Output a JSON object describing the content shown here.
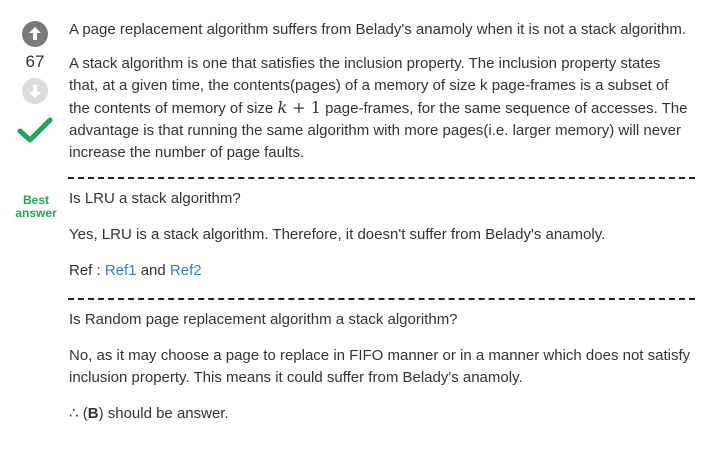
{
  "votes": {
    "count": "67",
    "upvote_icon": "arrow-up-circle-icon",
    "downvote_icon": "arrow-down-circle-icon",
    "accepted_icon": "checkmark-icon",
    "accepted_color": "#1ea756",
    "best_answer_line1": "Best",
    "best_answer_line2": "answer"
  },
  "answer": {
    "p1": "A page replacement algorithm suffers from Belady's anamoly when it is not a stack algorithm.",
    "p2_part1": "A stack algorithm is one that satisfies the inclusion property. The inclusion property states that, at a given time, the contents(pages) of a memory of size k page-frames is a subset of the contents of memory of size ",
    "p2_math_k": "k",
    "p2_math_plus": " + 1",
    "p2_part2": " page-frames, for the same sequence of accesses. The advantage is that running the same algorithm with more pages(i.e. larger memory) will never increase the number of page faults.",
    "q1": "Is LRU a stack algorithm?",
    "a1": "Yes, LRU is a stack algorithm. Therefore, it doesn't suffer from Belady's anamoly.",
    "ref_label": "Ref : ",
    "ref1": "Ref1",
    "ref_and": " and ",
    "ref2": "Ref2",
    "q2": "Is Random page replacement algorithm a stack algorithm?",
    "a2": "No, as it may choose a page to replace in FIFO manner or in a manner which does not satisfy inclusion property. This means it could suffer from Belady's anamoly.",
    "concl_prefix": "∴ (",
    "concl_bold": "B",
    "concl_suffix": ") should be answer.",
    "link_color": "#3a7bd5"
  }
}
